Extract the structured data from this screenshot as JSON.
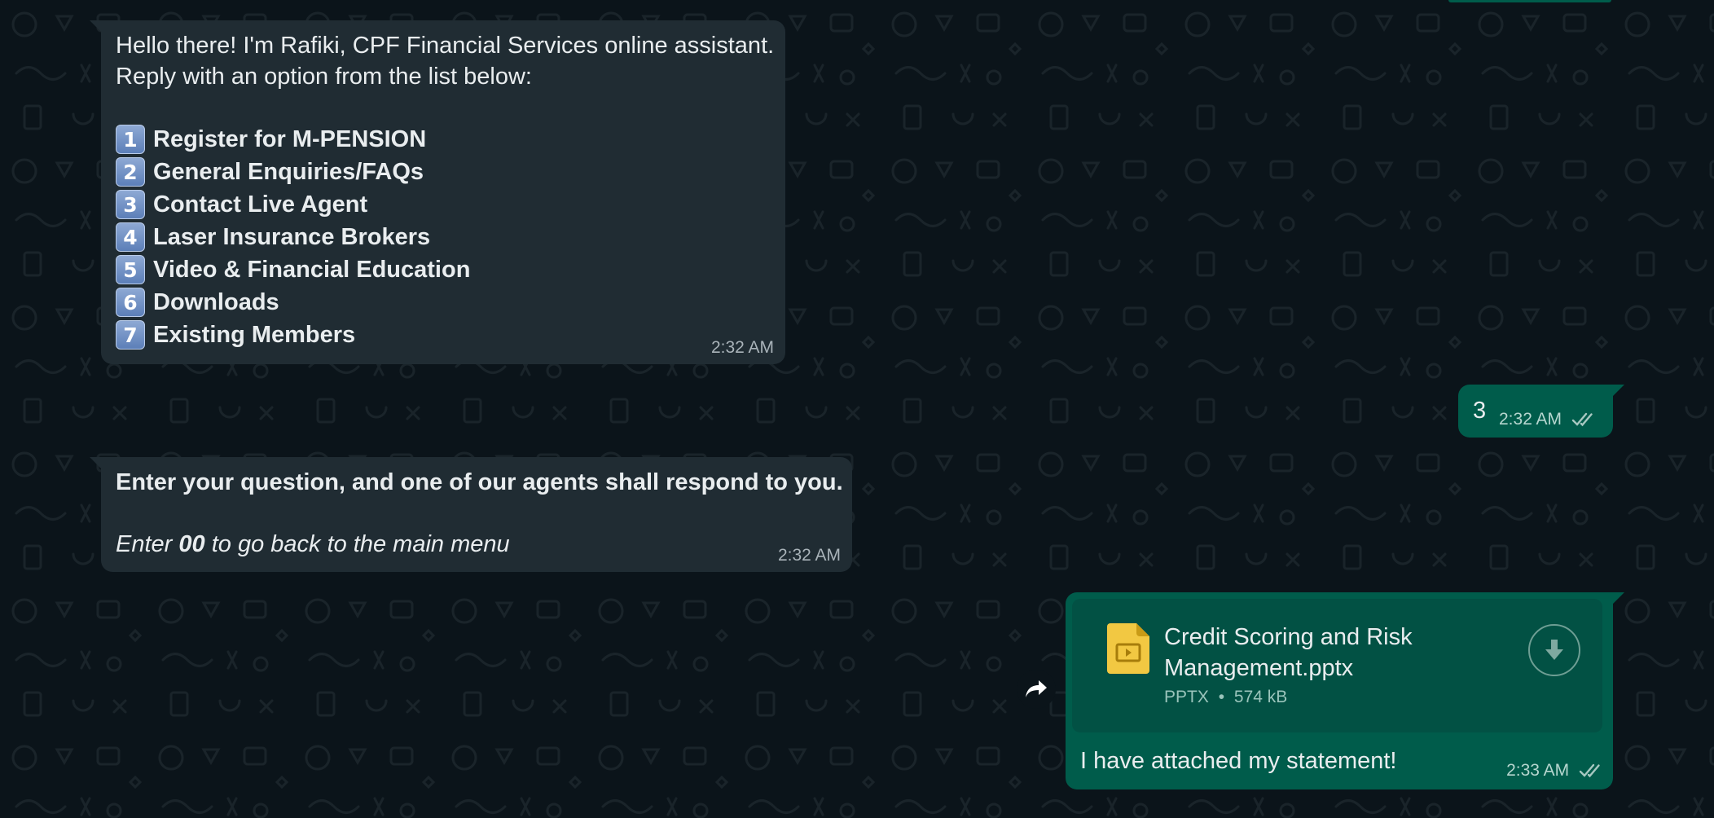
{
  "colors": {
    "background": "#0b141a",
    "incoming_bubble": "#202c33",
    "outgoing_bubble": "#005c4b",
    "doc_card": "#025144",
    "doc_icon": "#f2c842",
    "read_ticks": "#a7c8c1"
  },
  "messages": {
    "welcome": {
      "line1": "Hello there! I'm Rafiki, CPF Financial Services online assistant.",
      "line2": "Reply with an option from the list below:",
      "options": [
        {
          "num": "1",
          "label": "Register for M-PENSION"
        },
        {
          "num": "2",
          "label": "General Enquiries/FAQs"
        },
        {
          "num": "3",
          "label": "Contact Live Agent"
        },
        {
          "num": "4",
          "label": "Laser Insurance Brokers"
        },
        {
          "num": "5",
          "label": "Video & Financial Education"
        },
        {
          "num": "6",
          "label": "Downloads"
        },
        {
          "num": "7",
          "label": "Existing Members"
        }
      ],
      "time": "2:32 AM"
    },
    "reply_choice": {
      "text": "3",
      "time": "2:32 AM",
      "status_icon": "double-check-icon"
    },
    "agent_prompt": {
      "line1": "Enter your question, and one of our agents shall respond to you.",
      "line2_prefix": "Enter ",
      "line2_bold": "00",
      "line2_suffix": " to go back to the main menu",
      "time": "2:32 AM"
    },
    "attachment": {
      "file_name_line1": "Credit Scoring and Risk",
      "file_name_line2": "Management.pptx",
      "file_type": "PPTX",
      "separator": "•",
      "file_size": "574 kB",
      "caption": "I have attached my statement!",
      "time": "2:33 AM",
      "file_icon": "presentation-file-icon",
      "download_icon": "download-icon",
      "forward_icon": "forward-icon",
      "status_icon": "double-check-icon"
    }
  }
}
